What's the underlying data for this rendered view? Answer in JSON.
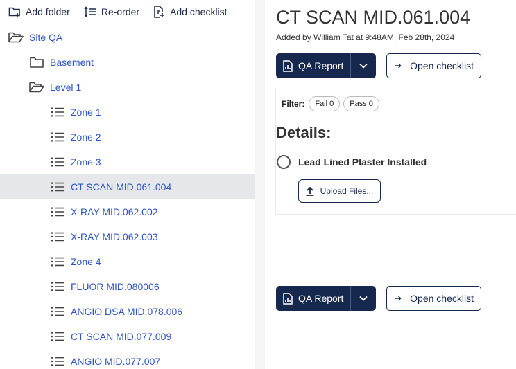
{
  "toolbar": {
    "add_folder": "Add folder",
    "reorder": "Re-order",
    "add_checklist": "Add checklist"
  },
  "tree": [
    {
      "label": "Site QA",
      "icon": "folder-open-icon",
      "level": 0,
      "selected": false
    },
    {
      "label": "Basement",
      "icon": "folder-icon",
      "level": 1,
      "selected": false
    },
    {
      "label": "Level 1",
      "icon": "folder-open-icon",
      "level": 1,
      "selected": false
    },
    {
      "label": "Zone 1",
      "icon": "list-icon",
      "level": 2,
      "selected": false
    },
    {
      "label": "Zone 2",
      "icon": "list-icon",
      "level": 2,
      "selected": false
    },
    {
      "label": "Zone 3",
      "icon": "list-icon",
      "level": 2,
      "selected": false
    },
    {
      "label": "CT SCAN MID.061.004",
      "icon": "list-icon",
      "level": 2,
      "selected": true
    },
    {
      "label": "X-RAY MID.062.002",
      "icon": "list-icon",
      "level": 2,
      "selected": false
    },
    {
      "label": "X-RAY MID.062.003",
      "icon": "list-icon",
      "level": 2,
      "selected": false
    },
    {
      "label": "Zone 4",
      "icon": "list-icon",
      "level": 2,
      "selected": false
    },
    {
      "label": "FLUOR MID.080006",
      "icon": "list-icon",
      "level": 2,
      "selected": false
    },
    {
      "label": "ANGIO DSA MID.078.006",
      "icon": "list-icon",
      "level": 2,
      "selected": false
    },
    {
      "label": "CT SCAN MID.077.009",
      "icon": "list-icon",
      "level": 2,
      "selected": false
    },
    {
      "label": "ANGIO MID.077.007",
      "icon": "list-icon",
      "level": 2,
      "selected": false
    }
  ],
  "detail": {
    "title": "CT SCAN MID.061.004",
    "subtitle": "Added by William Tat at 9:48AM, Feb 28th, 2024",
    "qa_report": "QA Report",
    "open_checklist": "Open checklist",
    "filter_label": "Filter:",
    "fail_pill": "Fail 0",
    "pass_pill": "Pass 0",
    "details_heading": "Details:",
    "check_item": "Lead Lined Plaster Installed",
    "upload_label": "Upload Files..."
  },
  "colors": {
    "primary": "#17284e",
    "link": "#2e55c6",
    "selected_row": "#e6e7ea"
  }
}
